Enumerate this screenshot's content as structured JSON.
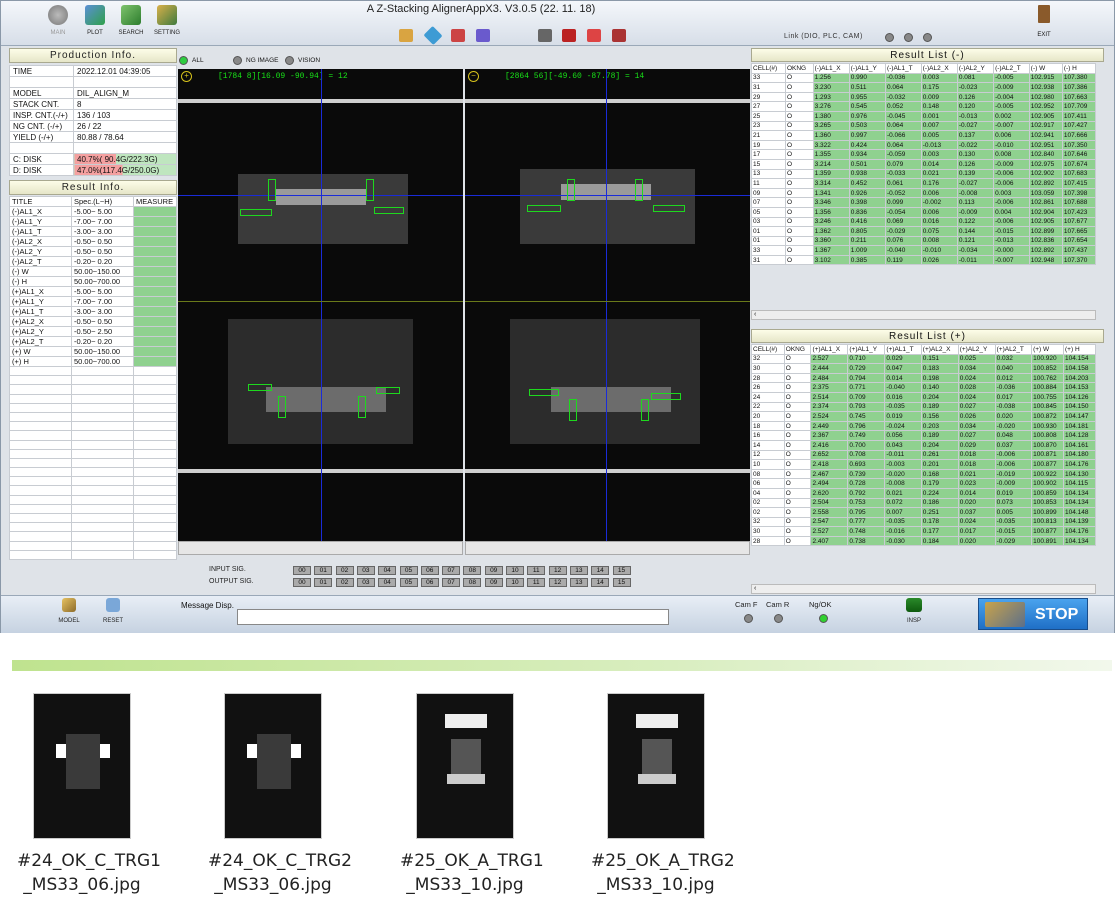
{
  "toolbar": {
    "left_buttons": [
      {
        "label": "MAIN",
        "icon": "main-gear-icon"
      },
      {
        "label": "PLOT",
        "icon": "plot-icon"
      },
      {
        "label": "SEARCH",
        "icon": "search-icon"
      },
      {
        "label": "SETTING",
        "icon": "setting-icon"
      }
    ],
    "title": "A Z-Stacking AlignerAppX3. V3.0.5 (22. 11. 18)",
    "link_label": "Link (DIO, PLC, CAM)",
    "exit_label": "EXIT"
  },
  "production": {
    "title": "Production Info.",
    "rows": [
      {
        "key": "TIME",
        "value": "2022.12.01  04:39:05"
      },
      {
        "key": "",
        "value": ""
      },
      {
        "key": "MODEL",
        "value": "DIL_ALIGN_M"
      },
      {
        "key": "STACK CNT.",
        "value": "8"
      },
      {
        "key": "INSP. CNT.(-/+)",
        "value": "136 / 103"
      },
      {
        "key": "NG CNT. (-/+)",
        "value": "26 / 22"
      },
      {
        "key": "YIELD (-/+)",
        "value": "80.88 / 78.64"
      },
      {
        "key": "",
        "value": ""
      },
      {
        "key": "C: DISK",
        "value": "40.7%( 90.4G/222.3G)",
        "fill": 0.407
      },
      {
        "key": "D: DISK",
        "value": "47.0%(117.4G/250.0G)",
        "fill": 0.47
      }
    ]
  },
  "result_info": {
    "title": "Result Info.",
    "headers": [
      "TITLE",
      "Spec.(L~H)",
      "MEASURE"
    ],
    "rows": [
      [
        "(-)AL1_X",
        "-5.00~ 5.00"
      ],
      [
        "(-)AL1_Y",
        "-7.00~ 7.00"
      ],
      [
        "(-)AL1_T",
        "-3.00~ 3.00"
      ],
      [
        "(-)AL2_X",
        "-0.50~ 0.50"
      ],
      [
        "(-)AL2_Y",
        "-0.50~ 0.50"
      ],
      [
        "(-)AL2_T",
        "-0.20~ 0.20"
      ],
      [
        "(-)  W",
        "50.00~150.00"
      ],
      [
        "(-)  H",
        "50.00~700.00"
      ],
      [
        "(+)AL1_X",
        "-5.00~ 5.00"
      ],
      [
        "(+)AL1_Y",
        "-7.00~ 7.00"
      ],
      [
        "(+)AL1_T",
        "-3.00~ 3.00"
      ],
      [
        "(+)AL2_X",
        "-0.50~ 0.50"
      ],
      [
        "(+)AL2_Y",
        "-0.50~ 2.50"
      ],
      [
        "(+)AL2_T",
        "-0.20~ 0.20"
      ],
      [
        "(+)  W",
        "50.00~150.00"
      ],
      [
        "(+)  H",
        "50.00~700.00"
      ]
    ],
    "empty_rows": 21
  },
  "view_tabs": {
    "all": "ALL",
    "ng_image": "NG IMAGE",
    "vision": "VISION"
  },
  "camera_left": {
    "sign": "+",
    "readout": "[1784 8][16.09 -90.94] = 12"
  },
  "camera_right": {
    "sign": "−",
    "readout": "[2864 56][-49.60 -87.78] = 14"
  },
  "signals": {
    "input_label": "INPUT  SIG.",
    "output_label": "OUTPUT SIG.",
    "channels": [
      "00",
      "01",
      "02",
      "03",
      "04",
      "05",
      "06",
      "07",
      "08",
      "09",
      "10",
      "11",
      "12",
      "13",
      "14",
      "15"
    ]
  },
  "result_minus": {
    "title": "Result List (-)",
    "headers": [
      "CELL(#)",
      "OKNG",
      "(-)AL1_X",
      "(-)AL1_Y",
      "(-)AL1_T",
      "(-)AL2_X",
      "(-)AL2_Y",
      "(-)AL2_T",
      "(-) W",
      "(-) H"
    ],
    "rows": [
      [
        "33",
        "O",
        "1.256",
        "0.990",
        "-0.036",
        "0.003",
        "0.081",
        "-0.005",
        "102.915",
        "107.380"
      ],
      [
        "31",
        "O",
        "3.230",
        "0.511",
        "0.064",
        "0.175",
        "-0.023",
        "-0.009",
        "102.938",
        "107.386"
      ],
      [
        "29",
        "O",
        "1.293",
        "0.955",
        "-0.032",
        "0.009",
        "0.126",
        "-0.004",
        "102.980",
        "107.663"
      ],
      [
        "27",
        "O",
        "3.276",
        "0.545",
        "0.052",
        "0.148",
        "0.120",
        "-0.005",
        "102.952",
        "107.709"
      ],
      [
        "25",
        "O",
        "1.380",
        "0.976",
        "-0.045",
        "0.001",
        "-0.013",
        "0.002",
        "102.905",
        "107.411"
      ],
      [
        "23",
        "O",
        "3.265",
        "0.503",
        "0.064",
        "0.007",
        "-0.027",
        "-0.007",
        "102.917",
        "107.427"
      ],
      [
        "21",
        "O",
        "1.360",
        "0.997",
        "-0.066",
        "0.005",
        "0.137",
        "0.006",
        "102.941",
        "107.666"
      ],
      [
        "19",
        "O",
        "3.322",
        "0.424",
        "0.064",
        "-0.013",
        "-0.022",
        "-0.010",
        "102.951",
        "107.350"
      ],
      [
        "17",
        "O",
        "1.355",
        "0.934",
        "-0.059",
        "0.003",
        "0.130",
        "0.008",
        "102.840",
        "107.646"
      ],
      [
        "15",
        "O",
        "3.214",
        "0.501",
        "0.079",
        "0.014",
        "0.126",
        "-0.009",
        "102.975",
        "107.674"
      ],
      [
        "13",
        "O",
        "1.359",
        "0.938",
        "-0.033",
        "0.021",
        "0.139",
        "-0.006",
        "102.902",
        "107.683"
      ],
      [
        "11",
        "O",
        "3.314",
        "0.452",
        "0.061",
        "0.176",
        "-0.027",
        "-0.006",
        "102.892",
        "107.415"
      ],
      [
        "09",
        "O",
        "1.341",
        "0.926",
        "-0.052",
        "0.006",
        "-0.008",
        "0.003",
        "103.059",
        "107.398"
      ],
      [
        "07",
        "O",
        "3.346",
        "0.398",
        "0.099",
        "-0.002",
        "0.113",
        "-0.006",
        "102.861",
        "107.688"
      ],
      [
        "05",
        "O",
        "1.356",
        "0.836",
        "-0.054",
        "0.006",
        "-0.009",
        "0.004",
        "102.904",
        "107.423"
      ],
      [
        "03",
        "O",
        "3.246",
        "0.416",
        "0.069",
        "0.016",
        "0.122",
        "-0.006",
        "102.905",
        "107.677"
      ],
      [
        "01",
        "O",
        "1.362",
        "0.805",
        "-0.029",
        "0.075",
        "0.144",
        "-0.015",
        "102.899",
        "107.665"
      ],
      [
        "01",
        "O",
        "3.360",
        "0.211",
        "0.076",
        "0.008",
        "0.121",
        "-0.013",
        "102.836",
        "107.654"
      ],
      [
        "33",
        "O",
        "1.367",
        "1.009",
        "-0.040",
        "-0.010",
        "-0.034",
        "-0.000",
        "102.892",
        "107.437"
      ],
      [
        "31",
        "O",
        "3.102",
        "0.385",
        "0.119",
        "0.026",
        "-0.011",
        "-0.007",
        "102.948",
        "107.370"
      ]
    ]
  },
  "result_plus": {
    "title": "Result List (+)",
    "headers": [
      "CELL(#)",
      "OKNG",
      "(+)AL1_X",
      "(+)AL1_Y",
      "(+)AL1_T",
      "(+)AL2_X",
      "(+)AL2_Y",
      "(+)AL2_T",
      "(+) W",
      "(+) H"
    ],
    "rows": [
      [
        "32",
        "O",
        "2.527",
        "0.710",
        "0.029",
        "0.151",
        "0.025",
        "0.032",
        "100.920",
        "104.154"
      ],
      [
        "30",
        "O",
        "2.444",
        "0.729",
        "0.047",
        "0.183",
        "0.034",
        "0.040",
        "100.852",
        "104.158"
      ],
      [
        "28",
        "O",
        "2.484",
        "0.794",
        "0.014",
        "0.198",
        "0.024",
        "0.012",
        "100.762",
        "104.203"
      ],
      [
        "26",
        "O",
        "2.375",
        "0.771",
        "-0.040",
        "0.140",
        "0.028",
        "-0.036",
        "100.884",
        "104.153"
      ],
      [
        "24",
        "O",
        "2.514",
        "0.709",
        "0.016",
        "0.204",
        "0.024",
        "0.017",
        "100.755",
        "104.126"
      ],
      [
        "22",
        "O",
        "2.374",
        "0.793",
        "-0.035",
        "0.189",
        "0.027",
        "-0.038",
        "100.845",
        "104.150"
      ],
      [
        "20",
        "O",
        "2.524",
        "0.745",
        "0.019",
        "0.156",
        "0.026",
        "0.020",
        "100.872",
        "104.147"
      ],
      [
        "18",
        "O",
        "2.449",
        "0.796",
        "-0.024",
        "0.203",
        "0.034",
        "-0.020",
        "100.930",
        "104.181"
      ],
      [
        "16",
        "O",
        "2.367",
        "0.749",
        "0.056",
        "0.189",
        "0.027",
        "0.048",
        "100.808",
        "104.128"
      ],
      [
        "14",
        "O",
        "2.416",
        "0.700",
        "0.043",
        "0.204",
        "0.029",
        "0.037",
        "100.870",
        "104.161"
      ],
      [
        "12",
        "O",
        "2.652",
        "0.708",
        "-0.011",
        "0.261",
        "0.018",
        "-0.006",
        "100.871",
        "104.180"
      ],
      [
        "10",
        "O",
        "2.418",
        "0.693",
        "-0.003",
        "0.201",
        "0.018",
        "-0.006",
        "100.877",
        "104.176"
      ],
      [
        "08",
        "O",
        "2.467",
        "0.739",
        "-0.020",
        "0.168",
        "0.021",
        "-0.019",
        "100.922",
        "104.130"
      ],
      [
        "06",
        "O",
        "2.494",
        "0.728",
        "-0.008",
        "0.179",
        "0.023",
        "-0.009",
        "100.902",
        "104.115"
      ],
      [
        "04",
        "O",
        "2.620",
        "0.792",
        "0.021",
        "0.224",
        "0.014",
        "0.019",
        "100.859",
        "104.134"
      ],
      [
        "02",
        "O",
        "2.504",
        "0.753",
        "0.072",
        "0.186",
        "0.020",
        "0.073",
        "100.853",
        "104.134"
      ],
      [
        "02",
        "O",
        "2.558",
        "0.795",
        "0.007",
        "0.251",
        "0.037",
        "0.005",
        "100.899",
        "104.148"
      ],
      [
        "32",
        "O",
        "2.547",
        "0.777",
        "-0.035",
        "0.178",
        "0.024",
        "-0.035",
        "100.813",
        "104.139"
      ],
      [
        "30",
        "O",
        "2.527",
        "0.748",
        "-0.016",
        "0.177",
        "0.017",
        "-0.015",
        "100.877",
        "104.176"
      ],
      [
        "28",
        "O",
        "2.407",
        "0.738",
        "-0.030",
        "0.184",
        "0.020",
        "-0.029",
        "100.891",
        "104.134"
      ]
    ]
  },
  "bottom": {
    "model_label": "MODEL",
    "reset_label": "RESET",
    "message_label": "Message Disp.",
    "message_value": "",
    "cam_f": "Cam F",
    "cam_r": "Cam R",
    "ngok": "Ng/OK",
    "insp_label": "INSP",
    "stop_label": "STOP"
  },
  "colors": {
    "ok_green": "#8fd18f",
    "overlay_green": "#18e018",
    "crosshair_blue": "#1a2bd8",
    "disk_red": "#f4a0a0",
    "stop_blue": "#2b82d9"
  },
  "thumbnails": [
    {
      "line1": "#24_OK_C_TRG1",
      "line2": "_MS33_06.jpg"
    },
    {
      "line1": "#24_OK_C_TRG2",
      "line2": "_MS33_06.jpg"
    },
    {
      "line1": "#25_OK_A_TRG1",
      "line2": "_MS33_10.jpg"
    },
    {
      "line1": "#25_OK_A_TRG2",
      "line2": "_MS33_10.jpg"
    }
  ]
}
